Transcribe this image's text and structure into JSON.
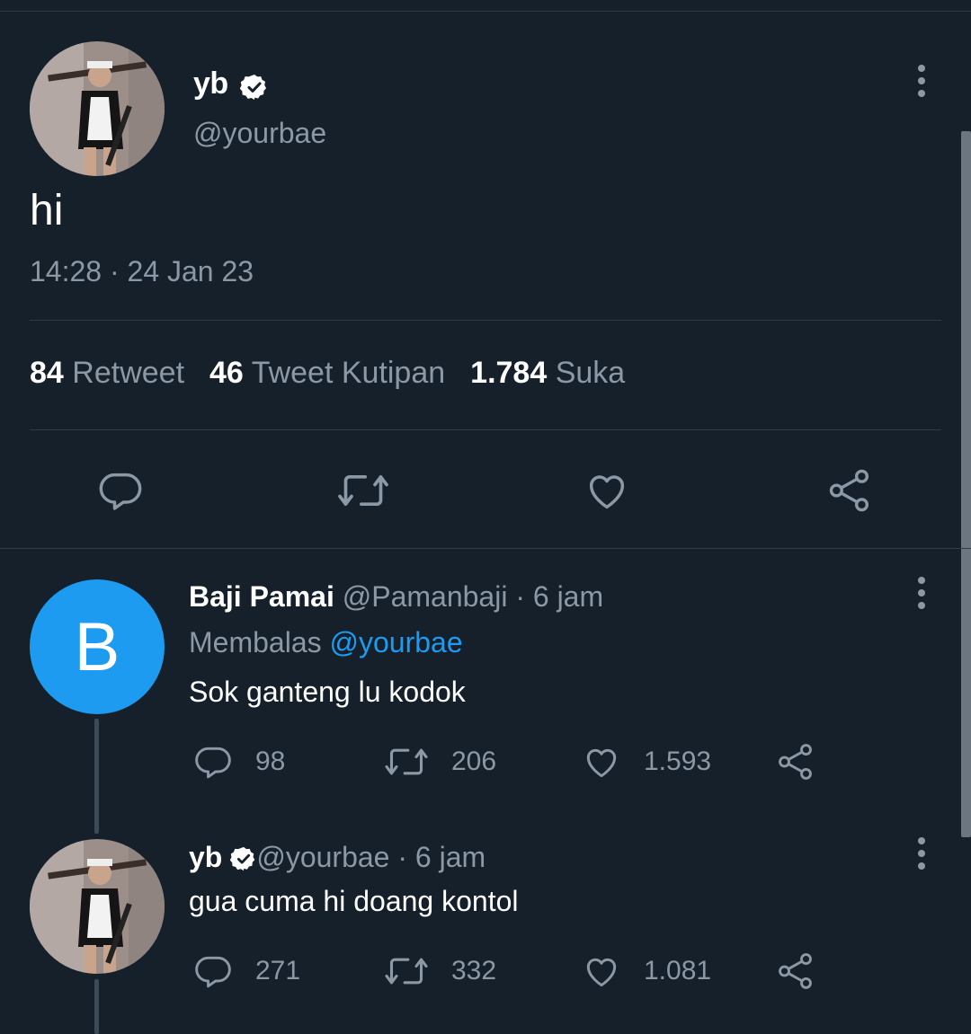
{
  "main_tweet": {
    "author_name": "yb",
    "author_handle": "@yourbae",
    "text": "hi",
    "timestamp": "14:28 · 24 Jan 23",
    "stats": {
      "retweets_count": "84",
      "retweets_label": "Retweet",
      "quotes_count": "46",
      "quotes_label": "Tweet Kutipan",
      "likes_count": "1.784",
      "likes_label": "Suka"
    },
    "actions": [
      "reply-icon",
      "retweet-icon",
      "like-icon",
      "share-icon"
    ]
  },
  "replies": [
    {
      "avatar_letter": "B",
      "avatar_color": "#1d9bf0",
      "name": "Baji Pamai",
      "handle": "@Pamanbaji",
      "time": "· 6 jam",
      "replying_label": "Membalas",
      "replying_to": "@yourbae",
      "text": "Sok ganteng lu kodok",
      "replies_count": "98",
      "retweets_count": "206",
      "likes_count": "1.593"
    },
    {
      "name": "yb",
      "handle": "@yourbae",
      "time": "· 6 jam",
      "text": "gua cuma hi doang kontol",
      "replies_count": "271",
      "retweets_count": "332",
      "likes_count": "1.081"
    }
  ],
  "colors": {
    "background": "#15202b",
    "muted_text": "#8b98a5",
    "accent": "#1d9bf0",
    "divider": "#2f3c49"
  }
}
